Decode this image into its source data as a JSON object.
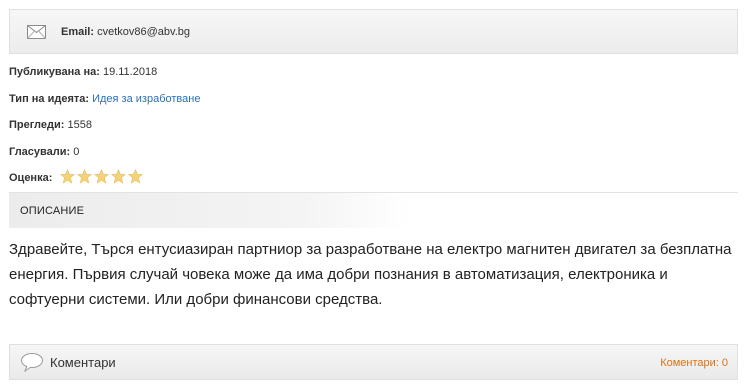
{
  "contact": {
    "icon": "envelope-icon",
    "email_label": "Email:",
    "email_value": "cvetkov86@abv.bg"
  },
  "meta": {
    "published_label": "Публикувана на:",
    "published_value": "19.11.2018",
    "type_label": "Тип на идеята:",
    "type_value": "Идея за изработване",
    "views_label": "Прегледи:",
    "views_value": "1558",
    "votes_label": "Гласували:",
    "votes_value": "0",
    "rating_label": "Оценка:",
    "rating_stars_total": 5,
    "rating_stars_filled": 0
  },
  "description": {
    "heading": "ОПИСАНИЕ",
    "text": "Здравейте, Търся ентусиазиран партниор за разработване на електро магнитен двигател за безплатна енергия. Първия случай човека може да има добри познания в автоматизация, електроника и софтуерни системи. Или добри финансови средства."
  },
  "comments": {
    "icon": "speech-bubble-icon",
    "label": "Коментари",
    "count_text": "Коментари: 0"
  },
  "colors": {
    "link": "#2e6fae",
    "accent": "#d2731d",
    "star": "#f2d27a"
  }
}
